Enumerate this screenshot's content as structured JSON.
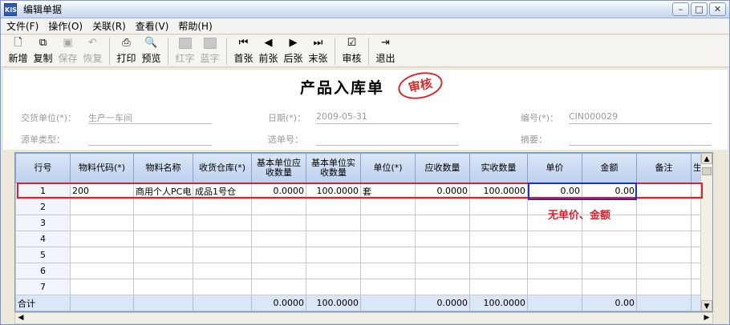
{
  "window": {
    "title": "编辑单据",
    "app_icon_text": "KIS"
  },
  "menu": [
    "文件(F)",
    "操作(O)",
    "关联(R)",
    "查看(V)",
    "帮助(H)"
  ],
  "toolbar": {
    "new": "新增",
    "copy": "复制",
    "save": "保存",
    "restore": "恢复",
    "print": "打印",
    "preview": "预览",
    "red": "红字",
    "blue": "蓝字",
    "first": "首张",
    "prev": "前张",
    "next": "后张",
    "last": "末张",
    "audit": "审核",
    "exit": "退出"
  },
  "document": {
    "title": "产品入库单",
    "stamp": "审核",
    "fields": {
      "delivery_unit_label": "交货单位(*)：",
      "delivery_unit_value": "生产一车间",
      "date_label": "日期(*)：",
      "date_value": "2009-05-31",
      "number_label": "编号(*)：",
      "number_value": "CIN000029",
      "source_type_label": "源单类型：",
      "select_number_label": "选单号：",
      "summary_label": "摘要："
    }
  },
  "grid": {
    "headers": [
      "行号",
      "物料代码(*)",
      "物料名称",
      "收货仓库(*)",
      "基本单位应收数量",
      "基本单位实收数量",
      "单位(*)",
      "应收数量",
      "实收数量",
      "单价",
      "金额",
      "备注",
      "生"
    ],
    "rows": [
      [
        "1",
        "200",
        "商用个人PC电",
        "成品1号仓",
        "0.0000",
        "100.0000",
        "套",
        "0.0000",
        "100.0000",
        "0.00",
        "0.00",
        "",
        ""
      ],
      [
        "2",
        "",
        "",
        "",
        "",
        "",
        "",
        "",
        "",
        "",
        "",
        "",
        ""
      ],
      [
        "3",
        "",
        "",
        "",
        "",
        "",
        "",
        "",
        "",
        "",
        "",
        "",
        ""
      ],
      [
        "4",
        "",
        "",
        "",
        "",
        "",
        "",
        "",
        "",
        "",
        "",
        "",
        ""
      ],
      [
        "5",
        "",
        "",
        "",
        "",
        "",
        "",
        "",
        "",
        "",
        "",
        "",
        ""
      ],
      [
        "6",
        "",
        "",
        "",
        "",
        "",
        "",
        "",
        "",
        "",
        "",
        "",
        ""
      ],
      [
        "7",
        "",
        "",
        "",
        "",
        "",
        "",
        "",
        "",
        "",
        "",
        "",
        ""
      ]
    ],
    "total": [
      "合计",
      "",
      "",
      "",
      "0.0000",
      "100.0000",
      "",
      "0.0000",
      "100.0000",
      "",
      "0.00",
      "",
      ""
    ]
  },
  "annotation": "无单价、金额"
}
